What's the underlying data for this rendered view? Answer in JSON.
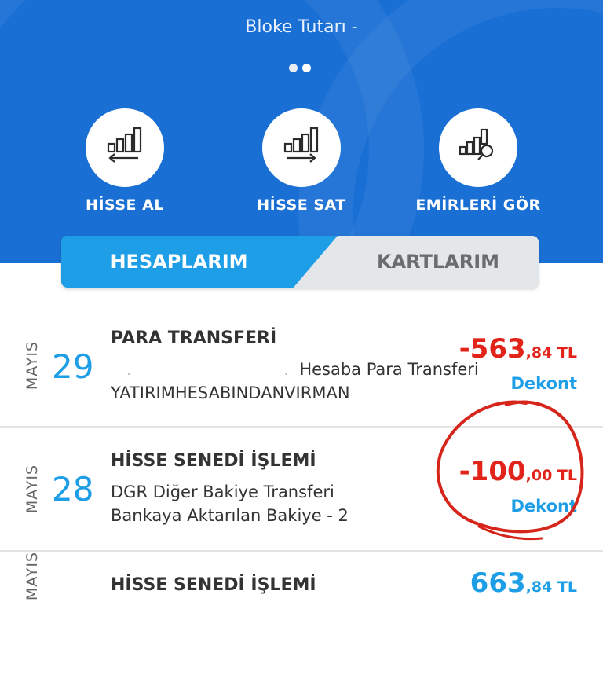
{
  "header": {
    "bloke_label": "Bloke Tutarı -",
    "actions": [
      {
        "label": "HİSSE AL",
        "icon": "stock-buy-icon"
      },
      {
        "label": "HİSSE SAT",
        "icon": "stock-sell-icon"
      },
      {
        "label": "EMİRLERİ GÖR",
        "icon": "view-orders-icon"
      }
    ]
  },
  "tabs": {
    "active": "HESAPLARIM",
    "inactive": "KARTLARIM"
  },
  "transactions": [
    {
      "month": "MAYIS",
      "day": "29",
      "title": "PARA TRANSFERİ",
      "desc1": "Hesaba Para Transferi",
      "desc2": "YATIRIMHESABINDANVIRMAN",
      "amount_int": "-563",
      "amount_frac": ",84 TL",
      "action": "Dekont"
    },
    {
      "month": "MAYIS",
      "day": "28",
      "title": "HİSSE SENEDİ İŞLEMİ",
      "desc1": "DGR  Diğer Bakiye Transferi",
      "desc2": "Bankaya Aktarılan Bakiye - 2",
      "amount_int": "-100",
      "amount_frac": ",00 TL",
      "action": "Dekont"
    },
    {
      "month": "MAYIS",
      "day": "",
      "title": "HİSSE SENEDİ İŞLEMİ",
      "desc1": "",
      "desc2": "",
      "amount_int": "663",
      "amount_frac": ",84 TL",
      "action": ""
    }
  ],
  "colors": {
    "header_blue": "#1a6fd4",
    "tab_active": "#1d9ee6",
    "negative_amount": "#e2231a",
    "positive_amount": "#1d9ee6",
    "annotation": "#d6261c"
  }
}
